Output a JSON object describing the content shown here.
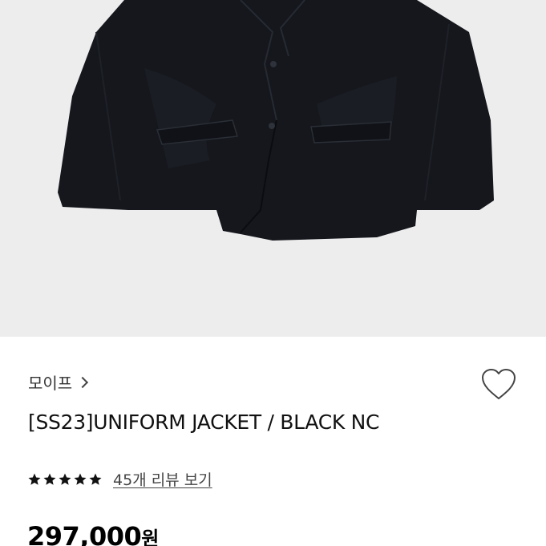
{
  "product": {
    "image_alt": "jacket-photo",
    "brand": "모이프",
    "title": "[SS23]UNIFORM JACKET / BLACK NC",
    "rating": 5,
    "rating_max": 5,
    "review_link": "45개 리뷰 보기",
    "price": "297,000",
    "price_unit": "원"
  },
  "colors": {
    "image_bg": "#ededed",
    "jacket": "#15171d",
    "star": "#111111"
  }
}
